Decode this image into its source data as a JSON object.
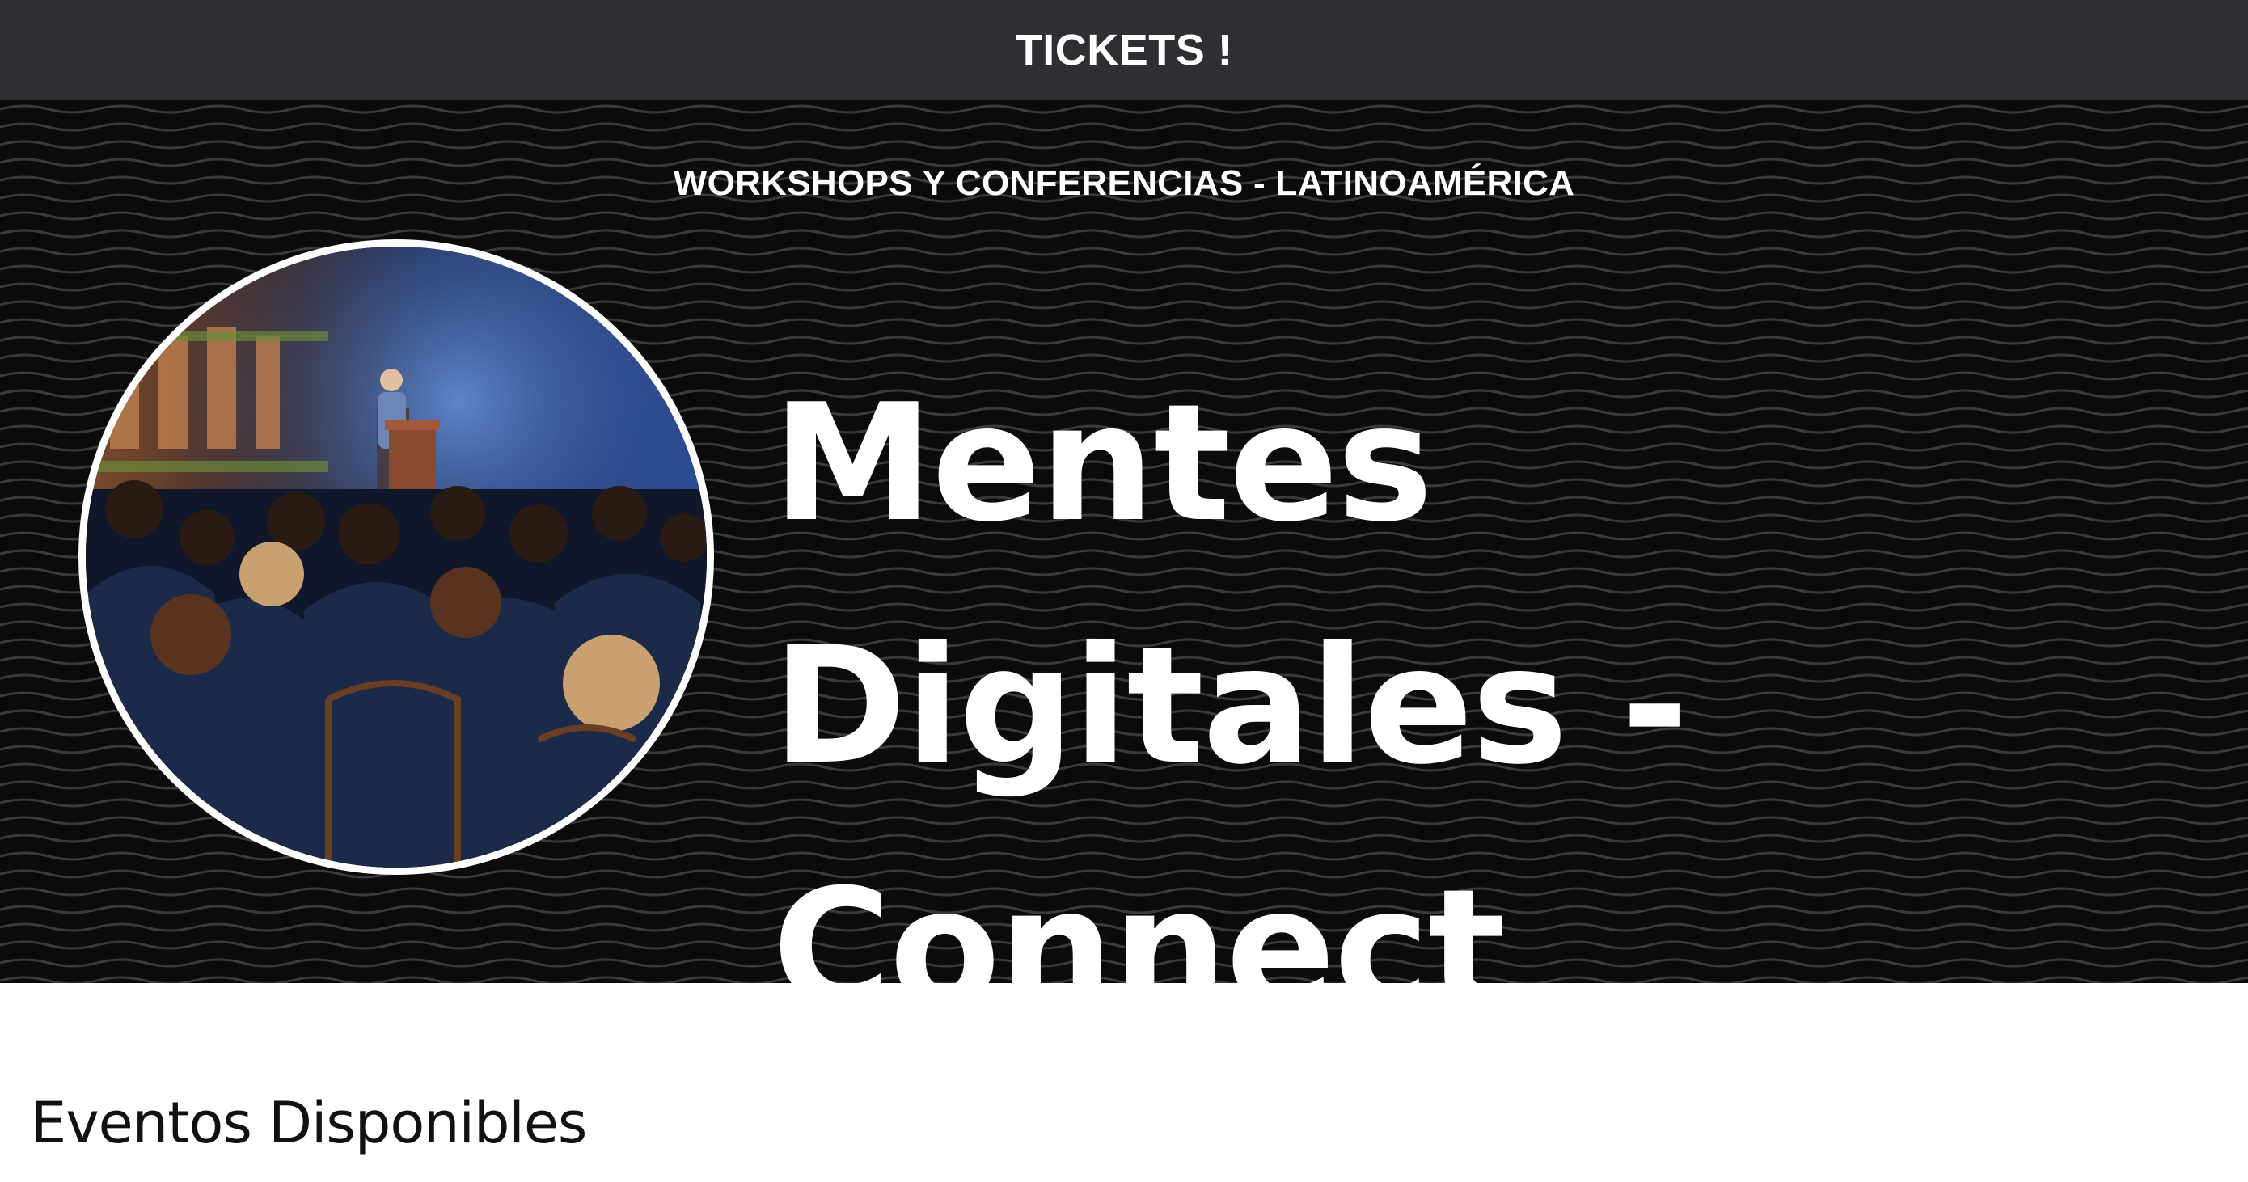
{
  "header": {
    "title": "TICKETS !"
  },
  "hero": {
    "subtitle": "WORKSHOPS Y CONFERENCIAS - LATINOAMÉRICA",
    "title": "Mentes Digitales - Connect",
    "image_alt": "Conference audience watching speaker at podium"
  },
  "section": {
    "heading": "Eventos Disponibles"
  },
  "colors": {
    "topbar_bg": "#2f2e33",
    "hero_bg": "#0b0b0b",
    "text_light": "#ffffff",
    "text_dark": "#111111"
  }
}
